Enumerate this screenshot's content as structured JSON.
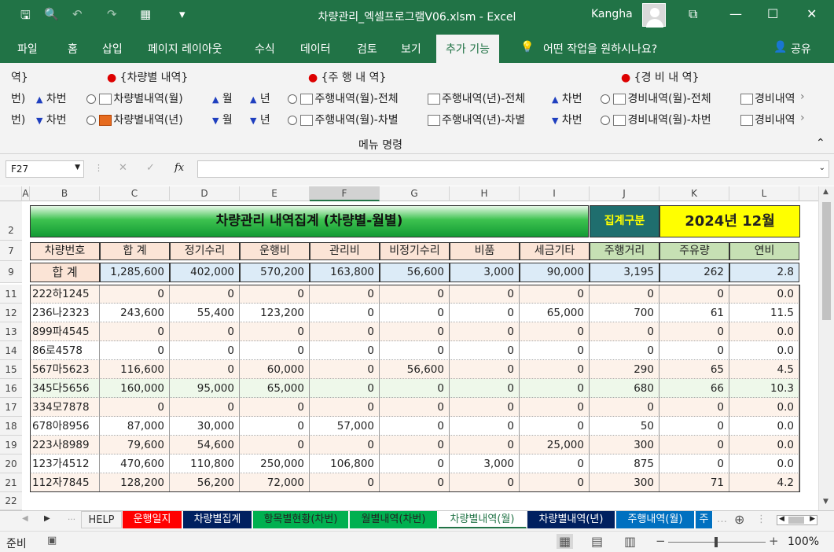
{
  "window": {
    "file_title": "차량관리_엑셀프로그램V06.xlsm",
    "sep": "-",
    "app": "Excel",
    "user": "Kangha",
    "search": "어떤 작업을 원하시나요?",
    "share": "공유"
  },
  "tabs": [
    "파일",
    "홈",
    "삽입",
    "페이지 레이아웃",
    "수식",
    "데이터",
    "검토",
    "보기",
    "추가 기능"
  ],
  "ribbon": {
    "g1_title": "역}",
    "g1_r1": "차번",
    "g1_r2": "차번",
    "g2_title": "{차량별 내역}",
    "g2_r1": "차량별내역(월)",
    "g2_r2": "차량별내역(년)",
    "g2_m1": "월",
    "g2_y1": "년",
    "g2_m2": "월",
    "g2_y2": "년",
    "g3_title": "{주 행 내 역}",
    "g3_r1a": "주행내역(월)-전체",
    "g3_r1b": "주행내역(년)-전체",
    "g3_r2a": "주행내역(월)-차별",
    "g3_r2b": "주행내역(년)-차별",
    "g3_r1c": "차번",
    "g3_r2c": "차번",
    "g4_title": "{경 비 내 역}",
    "g4_r1a": "경비내역(월)-전체",
    "g4_r1b": "경비내역",
    "g4_r2a": "경비내역(월)-차번",
    "g4_r2b": "경비내역",
    "group_label": "메뉴 명령",
    "g1_r0": "번)"
  },
  "namebox": "F27",
  "fx": "fx",
  "columns": [
    "A",
    "B",
    "C",
    "D",
    "E",
    "F",
    "G",
    "H",
    "I",
    "J",
    "K",
    "L"
  ],
  "sheet": {
    "title": "차량관리 내역집계 (차량별-월별)",
    "category_label": "집계구분",
    "period": "2024년 12월",
    "headers": [
      "차량번호",
      "합  계",
      "정기수리",
      "운행비",
      "관리비",
      "비정기수리",
      "비품",
      "세금기타",
      "주행거리",
      "주유량",
      "연비"
    ],
    "total_label": "합  계",
    "totals": [
      "1,285,600",
      "402,000",
      "570,200",
      "163,800",
      "56,600",
      "3,000",
      "90,000",
      "3,195",
      "262",
      "2.8"
    ],
    "rows": [
      {
        "n": "11",
        "c": [
          "222하1245",
          "0",
          "0",
          "0",
          "0",
          "0",
          "0",
          "0",
          "0",
          "0",
          "0.0"
        ]
      },
      {
        "n": "12",
        "c": [
          "236나2323",
          "243,600",
          "55,400",
          "123,200",
          "0",
          "0",
          "0",
          "65,000",
          "700",
          "61",
          "11.5"
        ]
      },
      {
        "n": "13",
        "c": [
          "899파4545",
          "0",
          "0",
          "0",
          "0",
          "0",
          "0",
          "0",
          "0",
          "0",
          "0.0"
        ]
      },
      {
        "n": "14",
        "c": [
          "86로4578",
          "0",
          "0",
          "0",
          "0",
          "0",
          "0",
          "0",
          "0",
          "0",
          "0.0"
        ]
      },
      {
        "n": "15",
        "c": [
          "567마5623",
          "116,600",
          "0",
          "60,000",
          "0",
          "56,600",
          "0",
          "0",
          "290",
          "65",
          "4.5"
        ]
      },
      {
        "n": "16",
        "c": [
          "345다5656",
          "160,000",
          "95,000",
          "65,000",
          "0",
          "0",
          "0",
          "0",
          "680",
          "66",
          "10.3"
        ]
      },
      {
        "n": "17",
        "c": [
          "334모7878",
          "0",
          "0",
          "0",
          "0",
          "0",
          "0",
          "0",
          "0",
          "0",
          "0.0"
        ]
      },
      {
        "n": "18",
        "c": [
          "678아8956",
          "87,000",
          "30,000",
          "0",
          "57,000",
          "0",
          "0",
          "0",
          "50",
          "0",
          "0.0"
        ]
      },
      {
        "n": "19",
        "c": [
          "223사8989",
          "79,600",
          "54,600",
          "0",
          "0",
          "0",
          "0",
          "25,000",
          "300",
          "0",
          "0.0"
        ]
      },
      {
        "n": "20",
        "c": [
          "123가4512",
          "470,600",
          "110,800",
          "250,000",
          "106,800",
          "0",
          "3,000",
          "0",
          "875",
          "0",
          "0.0"
        ]
      },
      {
        "n": "21",
        "c": [
          "112자7845",
          "128,200",
          "56,200",
          "72,000",
          "0",
          "0",
          "0",
          "0",
          "300",
          "71",
          "4.2"
        ]
      }
    ],
    "row_numbers": [
      "2",
      "7",
      "9",
      "22"
    ]
  },
  "sheet_tabs": [
    "HELP",
    "운행일지",
    "차량별집계",
    "항목별현황(차번)",
    "월별내역(차번)",
    "차량별내역(월)",
    "차량별내역(년)",
    "주행내역(월)",
    "주"
  ],
  "status": {
    "ready": "준비",
    "zoom": "100%"
  },
  "colors": {
    "excel_green": "#217346",
    "title_grad_start": "#1fb84a",
    "period_bg": "#ffff00",
    "teal": "#1f6e6e",
    "header_pink": "#fbe4d6",
    "total_blue": "#dcebf7"
  }
}
